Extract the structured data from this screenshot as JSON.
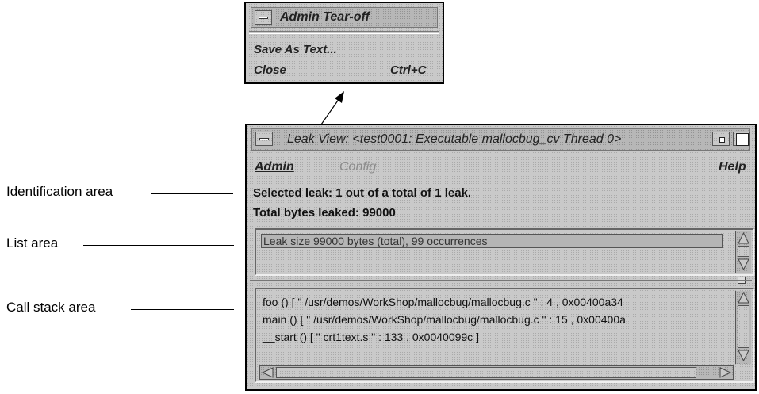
{
  "callouts": {
    "identification": "Identification area",
    "list": "List area",
    "call_stack": "Call stack area"
  },
  "tearoff_menu": {
    "title": "Admin Tear-off",
    "items": [
      {
        "label": "Save As Text...",
        "shortcut": ""
      },
      {
        "label": "Close",
        "shortcut": "Ctrl+C"
      }
    ]
  },
  "leak_view": {
    "title": "Leak View: <test0001: Executable mallocbug_cv Thread 0>",
    "menu": {
      "admin": "Admin",
      "config": "Config",
      "help": "Help"
    },
    "identification": {
      "selected": "Selected leak: 1 out of a total of 1 leak.",
      "total": "Total bytes leaked: 99000"
    },
    "list": [
      "Leak size   99000 bytes (total), 99 occurrences"
    ],
    "call_stack": [
      "foo () [ \" /usr/demos/WorkShop/mallocbug/mallocbug.c \" : 4 , 0x00400a34",
      "main () [ \" /usr/demos/WorkShop/mallocbug/mallocbug.c \" : 15 , 0x00400a",
      "__start () [ \" crt1text.s \" : 133 , 0x0040099c ]"
    ]
  }
}
